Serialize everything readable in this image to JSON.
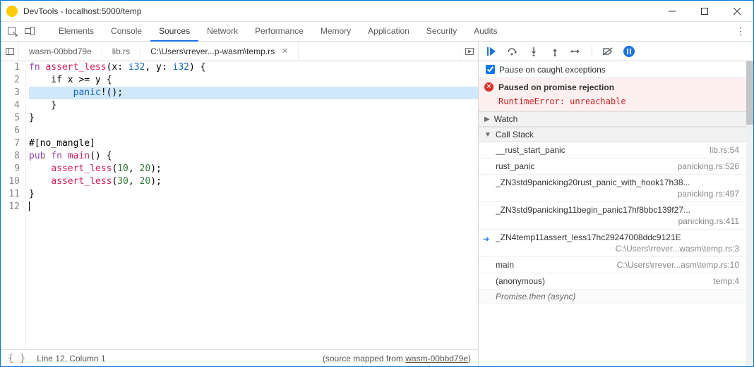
{
  "window": {
    "title": "DevTools - localhost:5000/temp"
  },
  "panels": {
    "items": [
      "Elements",
      "Console",
      "Sources",
      "Network",
      "Performance",
      "Memory",
      "Application",
      "Security",
      "Audits"
    ],
    "active_index": 2
  },
  "file_tabs": {
    "items": [
      {
        "label": "wasm-00bbd79e",
        "closable": false
      },
      {
        "label": "lib.rs",
        "closable": false
      },
      {
        "label": "C:\\Users\\rrever...p-wasm\\temp.rs",
        "closable": true
      }
    ],
    "active_index": 2
  },
  "source": {
    "highlighted_line": 3,
    "caret_line": 12,
    "lines": [
      [
        {
          "t": "fn ",
          "c": "kw"
        },
        {
          "t": "assert_less",
          "c": "fn"
        },
        {
          "t": "(x: ",
          "c": ""
        },
        {
          "t": "i32",
          "c": "tp"
        },
        {
          "t": ", y: ",
          "c": ""
        },
        {
          "t": "i32",
          "c": "tp"
        },
        {
          "t": ") {",
          "c": ""
        }
      ],
      [
        {
          "t": "    if x >= y {",
          "c": ""
        }
      ],
      [
        {
          "t": "        ",
          "c": ""
        },
        {
          "t": "panic",
          "c": "mac"
        },
        {
          "t": "!();",
          "c": ""
        }
      ],
      [
        {
          "t": "    }",
          "c": ""
        }
      ],
      [
        {
          "t": "}",
          "c": ""
        }
      ],
      [
        {
          "t": "",
          "c": ""
        }
      ],
      [
        {
          "t": "#[no_mangle]",
          "c": ""
        }
      ],
      [
        {
          "t": "pub fn ",
          "c": "kw"
        },
        {
          "t": "main",
          "c": "fn"
        },
        {
          "t": "() {",
          "c": ""
        }
      ],
      [
        {
          "t": "    ",
          "c": ""
        },
        {
          "t": "assert_less",
          "c": "fn"
        },
        {
          "t": "(",
          "c": ""
        },
        {
          "t": "10",
          "c": "num"
        },
        {
          "t": ", ",
          "c": ""
        },
        {
          "t": "20",
          "c": "num"
        },
        {
          "t": ");",
          "c": ""
        }
      ],
      [
        {
          "t": "    ",
          "c": ""
        },
        {
          "t": "assert_less",
          "c": "fn"
        },
        {
          "t": "(",
          "c": ""
        },
        {
          "t": "30",
          "c": "num"
        },
        {
          "t": ", ",
          "c": ""
        },
        {
          "t": "20",
          "c": "num"
        },
        {
          "t": ");",
          "c": ""
        }
      ],
      [
        {
          "t": "}",
          "c": ""
        }
      ],
      [
        {
          "t": "",
          "c": ""
        }
      ]
    ]
  },
  "status": {
    "position": "Line 12, Column 1",
    "source_mapped_prefix": "(source mapped from ",
    "source_mapped_link": "wasm-00bbd79e",
    "source_mapped_suffix": ")"
  },
  "debug": {
    "pause_checkbox": "Pause on caught exceptions",
    "pause_reason_title": "Paused on promise rejection",
    "pause_reason_msg": "RuntimeError: unreachable",
    "sections": {
      "watch": "Watch",
      "callstack": "Call Stack"
    },
    "frames": [
      {
        "name": "__rust_start_panic",
        "loc": "lib.rs:54"
      },
      {
        "name": "rust_panic",
        "loc": "panicking.rs:526"
      },
      {
        "name": "_ZN3std9panicking20rust_panic_with_hook17h38...",
        "loc": "panicking.rs:497",
        "multiline": true
      },
      {
        "name": "_ZN3std9panicking11begin_panic17hf8bbc139f27...",
        "loc": "panicking.rs:411",
        "multiline": true
      },
      {
        "name": "_ZN4temp11assert_less17hc29247008ddc9121E",
        "loc": "C:\\Users\\rrever...wasm\\temp.rs:3",
        "multiline": true,
        "current": true
      },
      {
        "name": "main",
        "loc": "C:\\Users\\rrever...asm\\temp.rs:10"
      },
      {
        "name": "(anonymous)",
        "loc": "temp:4"
      }
    ],
    "async_label": "Promise.then (async)"
  }
}
